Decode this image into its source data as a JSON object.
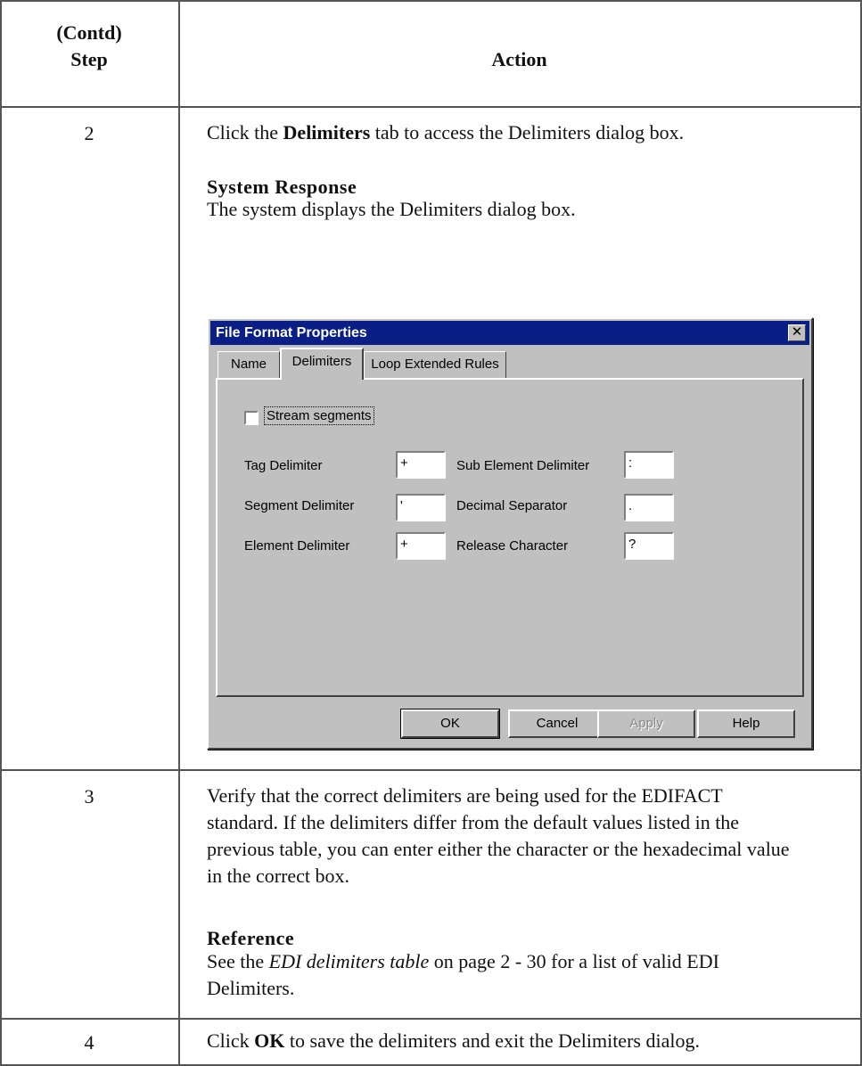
{
  "header": {
    "step_line1": "(Contd)",
    "step_line2": "Step",
    "action": "Action"
  },
  "rows": [
    {
      "step": "2"
    },
    {
      "step": "3"
    },
    {
      "step": "4"
    }
  ],
  "row2": {
    "line_pre": "Click the ",
    "line_bold": "Delimiters",
    "line_post": " tab to access the Delimiters dialog box.",
    "sub_heading": "System Response",
    "sub_text": "The system displays the Delimiters dialog box."
  },
  "dialog": {
    "title": "File Format Properties",
    "close_glyph": "✕",
    "tabs": [
      "Name",
      "Delimiters",
      "Loop Extended Rules"
    ],
    "stream_label": "Stream segments",
    "fields": {
      "tag_label": "Tag Delimiter",
      "tag_value": "+",
      "segment_label": "Segment Delimiter",
      "segment_value": "'",
      "element_label": "Element Delimiter",
      "element_value": "+",
      "subelement_label": "Sub Element Delimiter",
      "subelement_value": ":",
      "decimal_label": "Decimal Separator",
      "decimal_value": ".",
      "release_label": "Release Character",
      "release_value": "?"
    },
    "buttons": {
      "ok": "OK",
      "cancel": "Cancel",
      "apply": "Apply",
      "help": "Help"
    }
  },
  "row3": {
    "line1": "Verify that the correct delimiters are being used for the EDIFACT",
    "line2": "standard. If the delimiters differ from the default values listed in the",
    "line3": "previous table, you can enter either the character or the hexadecimal value",
    "line4": "in the correct box.",
    "ref_heading": "Reference",
    "ref_pre": "See the ",
    "ref_italic": "EDI delimiters table",
    "ref_post": " on page 2 - 30 for a list of valid EDI",
    "ref_line2": "Delimiters."
  },
  "row4": {
    "pre": "Click ",
    "bold": "OK",
    "post": " to save the delimiters and exit the Delimiters dialog."
  }
}
